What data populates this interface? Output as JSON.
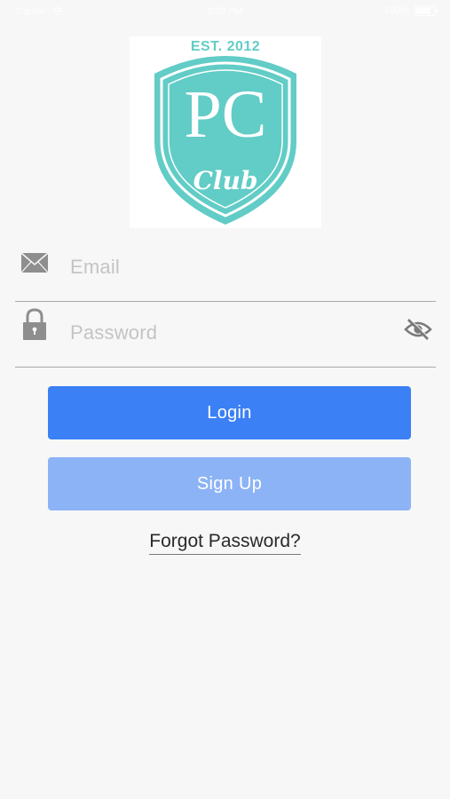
{
  "status_bar": {
    "carrier": "Carrier",
    "time": "3:59 PM",
    "battery_label": "100%"
  },
  "logo": {
    "est_text": "EST. 2012",
    "initials": "PC",
    "club_text": "Club",
    "color": "#62ccc6"
  },
  "email_field": {
    "placeholder": "Email",
    "icon": "envelope-icon"
  },
  "password_field": {
    "placeholder": "Password",
    "icon": "padlock-icon",
    "toggle_icon": "eye-slash-icon"
  },
  "buttons": {
    "login_label": "Login",
    "signup_label": "Sign Up",
    "login_color": "#3b80f5",
    "signup_color": "#8cb3f5"
  },
  "forgot_password_label": "Forgot Password?"
}
